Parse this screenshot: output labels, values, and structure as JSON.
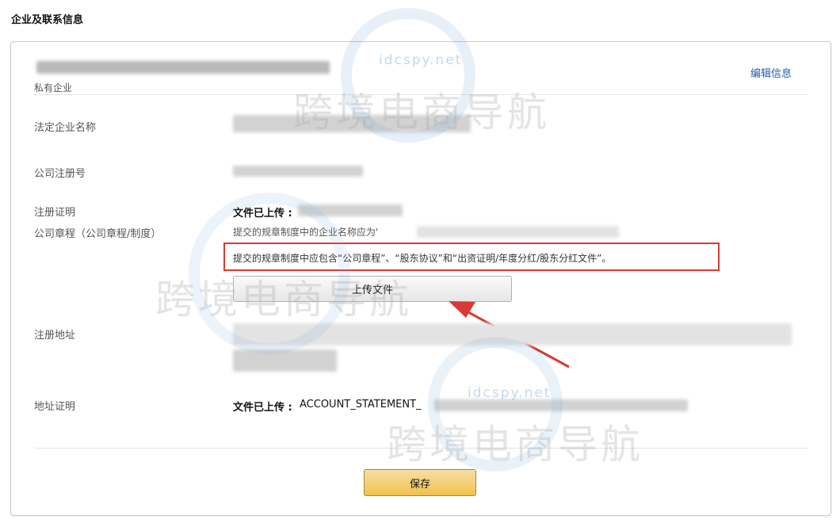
{
  "section": {
    "title": "企业及联系信息"
  },
  "card": {
    "company_type": "私有企业",
    "edit_label": "编辑信息",
    "fields": {
      "legal_name_label": "法定企业名称",
      "reg_no_label": "公司注册号",
      "reg_cert_label": "注册证明",
      "articles_label": "公司章程（公司章程/制度）",
      "reg_address_label": "注册地址",
      "address_proof_label": "地址证明"
    },
    "reg_cert": {
      "uploaded_prefix": "文件已上传 :"
    },
    "articles": {
      "hint_name": "提交的规章制度中的企业名称应为'",
      "hint_content": "提交的规章制度中应包含“公司章程”、“股东协议”和“出资证明/年度分红/股东分红文件”。"
    },
    "upload_label": "上传文件",
    "address_proof": {
      "uploaded_prefix": "文件已上传 :",
      "file_name": "ACCOUNT_STATEMENT_"
    },
    "save_label": "保存"
  },
  "watermark": {
    "text": "跨境电商导航",
    "domain": "idcspy.net"
  },
  "colors": {
    "annotation_red": "#d83a34",
    "link_blue": "#1d5ea8",
    "save_button": "#f0c14b"
  }
}
